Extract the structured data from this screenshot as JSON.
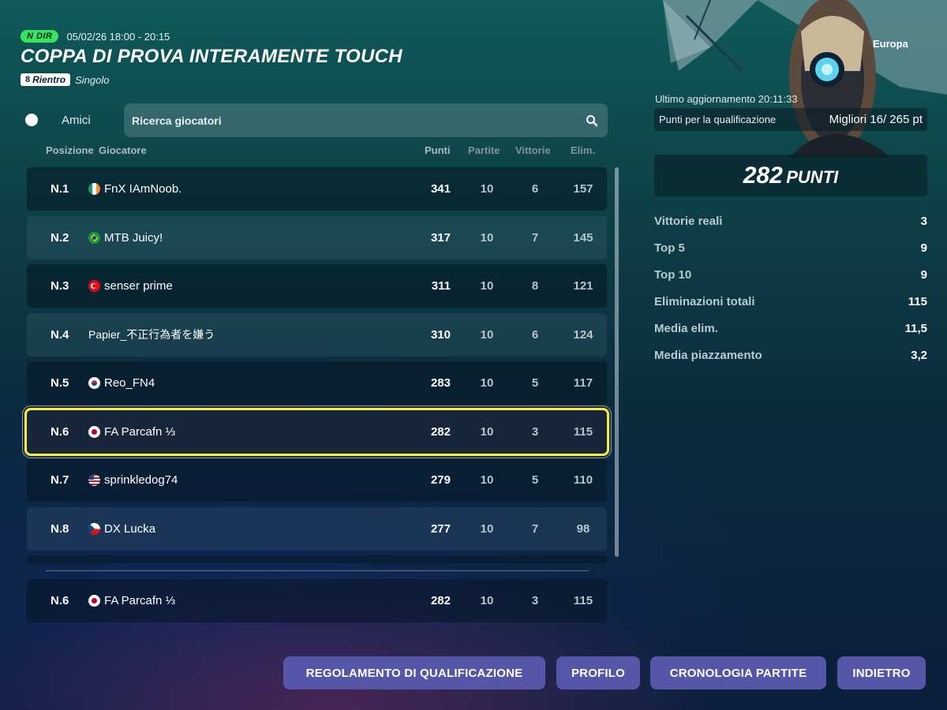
{
  "header": {
    "live_badge": "N DIR",
    "date_range": "05/02/26 18:00 - 20:15",
    "title": "COPPA DI PROVA INTERAMENTE TOUCH",
    "reentry_tag": "Rientro",
    "mode_tag": "Singolo"
  },
  "filters": {
    "friends_label": "Amici",
    "friends_toggle_on": false,
    "search_placeholder": "Ricerca giocatori"
  },
  "columns": {
    "position": "Posizione",
    "player": "Giocatore",
    "points": "Punti",
    "matches": "Partite",
    "wins": "Vittorie",
    "elims": "Elim."
  },
  "rows": [
    {
      "pos": "N.1",
      "name": "FnX IAmNoob.",
      "flag": "ireland",
      "points": "341",
      "matches": "10",
      "wins": "6",
      "elims": "157"
    },
    {
      "pos": "N.2",
      "name": "MTB Juicy!",
      "flag": "brazil",
      "points": "317",
      "matches": "10",
      "wins": "7",
      "elims": "145"
    },
    {
      "pos": "N.3",
      "name": "senser prime",
      "flag": "turkey",
      "points": "311",
      "matches": "10",
      "wins": "8",
      "elims": "121"
    },
    {
      "pos": "N.4",
      "name": "Papier_不正行為者を嫌う",
      "flag": "",
      "points": "310",
      "matches": "10",
      "wins": "6",
      "elims": "124"
    },
    {
      "pos": "N.5",
      "name": "Reo_FN4",
      "flag": "south-korea",
      "points": "283",
      "matches": "10",
      "wins": "5",
      "elims": "117"
    },
    {
      "pos": "N.6",
      "name": "FA Parcafn ⅓",
      "flag": "japan",
      "points": "282",
      "matches": "10",
      "wins": "3",
      "elims": "115"
    },
    {
      "pos": "N.7",
      "name": "sprinkledog74",
      "flag": "usa",
      "points": "279",
      "matches": "10",
      "wins": "5",
      "elims": "110"
    },
    {
      "pos": "N.8",
      "name": "DX Lucka",
      "flag": "czechia",
      "points": "277",
      "matches": "10",
      "wins": "7",
      "elims": "98"
    }
  ],
  "my_row": {
    "pos": "N.6",
    "name": "FA Parcafn ⅓",
    "flag": "japan",
    "points": "282",
    "matches": "10",
    "wins": "3",
    "elims": "115"
  },
  "panel": {
    "region": "Europa",
    "last_update": "Ultimo aggiornamento 20:11:33",
    "qualify_label": "Punti per la qualificazione",
    "qualify_value": "Migliori 16/ 265 pt",
    "points_big": "282",
    "points_unit": "PUNTI",
    "stats": [
      {
        "label": "Vittorie reali",
        "value": "3"
      },
      {
        "label": "Top 5",
        "value": "9"
      },
      {
        "label": "Top 10",
        "value": "9"
      },
      {
        "label": "Eliminazioni totali",
        "value": "115"
      },
      {
        "label": "Media elim.",
        "value": "11,5"
      },
      {
        "label": "Media piazzamento",
        "value": "3,2"
      }
    ]
  },
  "buttons": {
    "rules": "REGOLAMENTO DI QUALIFICAZIONE",
    "profile": "PROFILO",
    "history": "CRONOLOGIA PARTITE",
    "back": "INDIETRO"
  },
  "colors": {
    "highlight_outline": "#f6ef3b",
    "live_badge": "#39e25f",
    "button_bg": "#5656a9"
  }
}
